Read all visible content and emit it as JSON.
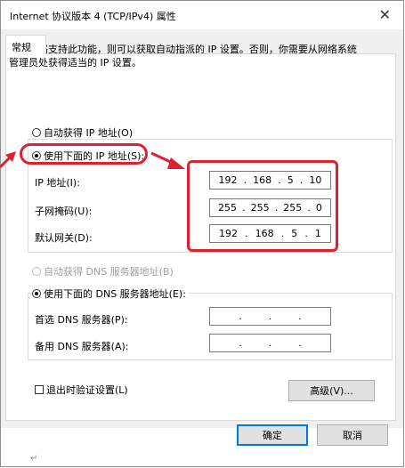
{
  "window": {
    "title": "Internet 协议版本 4 (TCP/IPv4) 属性"
  },
  "tab": {
    "label": "常规"
  },
  "description": "如果网络支持此功能，则可以获取自动指派的 IP 设置。否则，你需要从网络系统管理员处获得适当的 IP 设置。",
  "ip_section": {
    "auto_label": "自动获得 IP 地址(O)",
    "manual_label": "使用下面的 IP 地址(S):",
    "ip_label": "IP 地址(I):",
    "mask_label": "子网掩码(U):",
    "gateway_label": "默认网关(D):",
    "ip": [
      "192",
      "168",
      "5",
      "10"
    ],
    "mask": [
      "255",
      "255",
      "255",
      "0"
    ],
    "gateway": [
      "192",
      "168",
      "5",
      "1"
    ]
  },
  "dns_section": {
    "auto_label": "自动获得 DNS 服务器地址(B)",
    "manual_label": "使用下面的 DNS 服务器地址(E):",
    "preferred_label": "首选 DNS 服务器(P):",
    "alternate_label": "备用 DNS 服务器(A):"
  },
  "validate_label": "退出时验证设置(L)",
  "advanced_label": "高级(V)...",
  "ok_label": "确定",
  "cancel_label": "取消",
  "close_glyph": "✕",
  "dot": ".",
  "annotation_color": "#e02030",
  "accent": "#0078d7"
}
